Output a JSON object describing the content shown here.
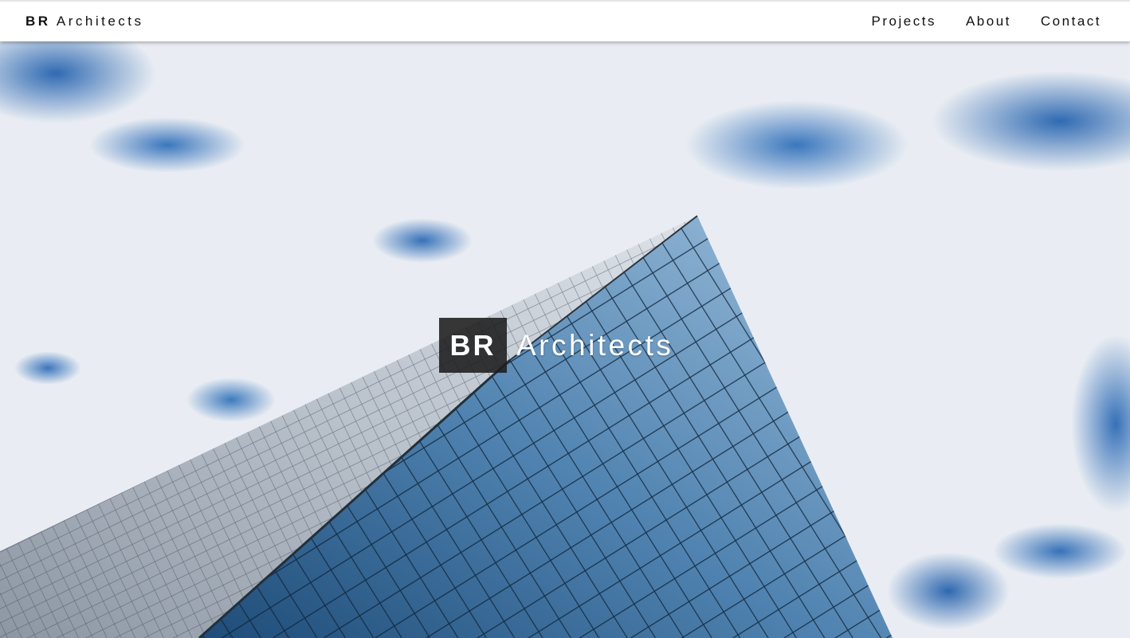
{
  "header": {
    "brand_bold": "BR",
    "brand_text": "Architects",
    "nav": [
      {
        "label": "Projects"
      },
      {
        "label": "About"
      },
      {
        "label": "Contact"
      }
    ]
  },
  "hero": {
    "title_box": "BR",
    "title_text": "Architects",
    "background_image": "glass skyscraper against cloudy blue sky"
  },
  "colors": {
    "header_bg": "#ffffff",
    "text_dark": "#111111",
    "title_box_bg": "#1c1c1c",
    "sky_blue": "#2f6ab2"
  }
}
